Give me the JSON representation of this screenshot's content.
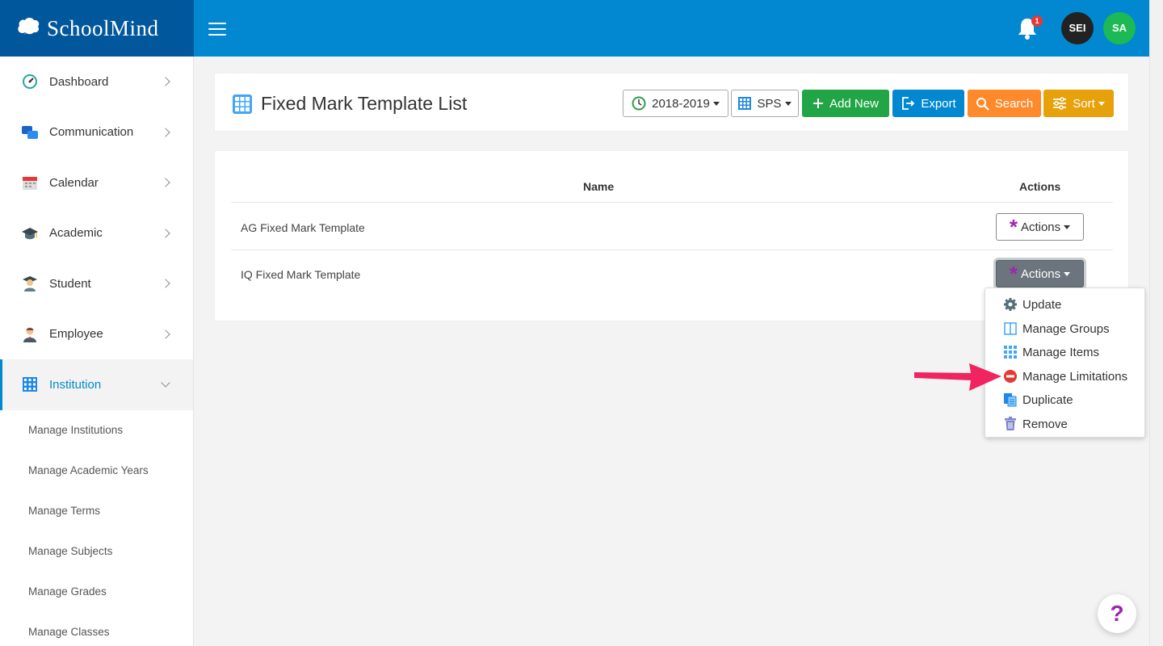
{
  "brand": {
    "name": "SchoolMind"
  },
  "header": {
    "notification_count": "1",
    "avatars": [
      "SEI",
      "SA"
    ]
  },
  "sidebar": {
    "items": [
      {
        "label": "Dashboard",
        "icon": "dashboard-gauge-icon"
      },
      {
        "label": "Communication",
        "icon": "chat-bubbles-icon"
      },
      {
        "label": "Calendar",
        "icon": "calendar-icon"
      },
      {
        "label": "Academic",
        "icon": "graduation-cap-icon"
      },
      {
        "label": "Student",
        "icon": "student-icon"
      },
      {
        "label": "Employee",
        "icon": "employee-icon"
      },
      {
        "label": "Institution",
        "icon": "building-icon",
        "active": true
      }
    ],
    "sub_items": [
      "Manage Institutions",
      "Manage Academic Years",
      "Manage Terms",
      "Manage Subjects",
      "Manage Grades",
      "Manage Classes"
    ]
  },
  "page": {
    "title": "Fixed Mark Template List",
    "toolbar": {
      "year": "2018-2019",
      "school": "SPS",
      "add_new": "Add New",
      "export": "Export",
      "search": "Search",
      "sort": "Sort"
    }
  },
  "table": {
    "headers": {
      "name": "Name",
      "actions": "Actions"
    },
    "rows": [
      {
        "name": "AG Fixed Mark Template",
        "action_label": "Actions"
      },
      {
        "name": "IQ Fixed Mark Template",
        "action_label": "Actions"
      }
    ]
  },
  "dropdown": {
    "items": [
      {
        "label": "Update",
        "icon": "gear-icon"
      },
      {
        "label": "Manage Groups",
        "icon": "columns-icon"
      },
      {
        "label": "Manage Items",
        "icon": "grid-icon"
      },
      {
        "label": "Manage Limitations",
        "icon": "no-entry-icon"
      },
      {
        "label": "Duplicate",
        "icon": "duplicate-icon"
      },
      {
        "label": "Remove",
        "icon": "trash-icon"
      }
    ]
  },
  "help": {
    "label": "?"
  },
  "colors": {
    "header": "#0288d1",
    "brand_bg": "#01579b",
    "accent_purple": "#9c27b0",
    "arrow": "#f0245f"
  }
}
